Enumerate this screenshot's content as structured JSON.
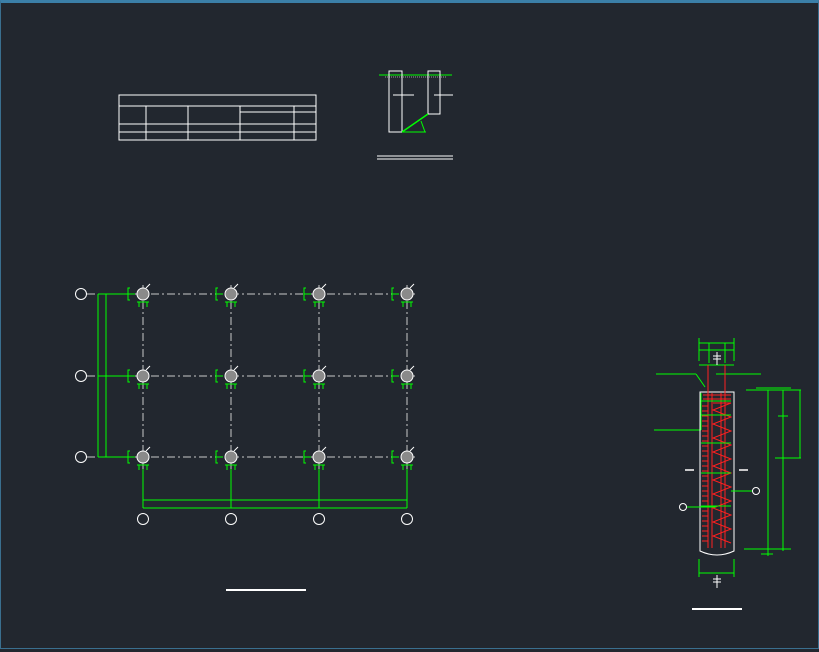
{
  "window": {
    "background": "#22272f",
    "frame_color": "#3b7fa8"
  },
  "colors": {
    "line_white": "#ffffff",
    "line_green": "#00ff00",
    "line_red": "#ff2020",
    "axis_gray": "#c8c8c8",
    "column_fill": "#8a8a8a"
  },
  "views": [
    {
      "id": "schedule-table",
      "icon": "table-grid"
    },
    {
      "id": "foundation-section",
      "icon": "section-detail"
    },
    {
      "id": "pile-layout-plan",
      "icon": "grid-plan",
      "grid_cols": 4,
      "grid_rows": 3
    },
    {
      "id": "pile-reinforcement-detail",
      "icon": "pile-elevation"
    }
  ]
}
